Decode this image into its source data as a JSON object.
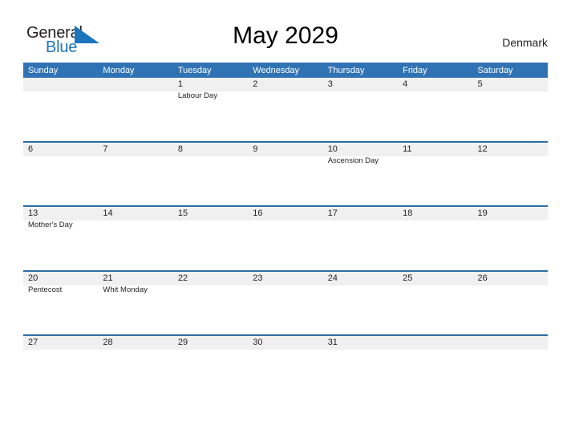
{
  "brand": {
    "name_part1": "General",
    "name_part2": "Blue",
    "flag_icon": "triangle-flag-icon",
    "flag_color": "#1c75bc"
  },
  "header": {
    "title": "May 2029",
    "country": "Denmark"
  },
  "theme": {
    "header_blue": "#3073b4",
    "separator_blue": "#2e6da4",
    "band_grey": "#f0f0f0",
    "text_dark": "#231f20",
    "logo_blue": "#1c75bc"
  },
  "calendar": {
    "month": "May",
    "year": "2029",
    "weekday_headers": [
      "Sunday",
      "Monday",
      "Tuesday",
      "Wednesday",
      "Thursday",
      "Friday",
      "Saturday"
    ],
    "weeks": [
      [
        {
          "day": "",
          "event": ""
        },
        {
          "day": "",
          "event": ""
        },
        {
          "day": "1",
          "event": "Labour Day"
        },
        {
          "day": "2",
          "event": ""
        },
        {
          "day": "3",
          "event": ""
        },
        {
          "day": "4",
          "event": ""
        },
        {
          "day": "5",
          "event": ""
        }
      ],
      [
        {
          "day": "6",
          "event": ""
        },
        {
          "day": "7",
          "event": ""
        },
        {
          "day": "8",
          "event": ""
        },
        {
          "day": "9",
          "event": ""
        },
        {
          "day": "10",
          "event": "Ascension Day"
        },
        {
          "day": "11",
          "event": ""
        },
        {
          "day": "12",
          "event": ""
        }
      ],
      [
        {
          "day": "13",
          "event": "Mother's Day"
        },
        {
          "day": "14",
          "event": ""
        },
        {
          "day": "15",
          "event": ""
        },
        {
          "day": "16",
          "event": ""
        },
        {
          "day": "17",
          "event": ""
        },
        {
          "day": "18",
          "event": ""
        },
        {
          "day": "19",
          "event": ""
        }
      ],
      [
        {
          "day": "20",
          "event": "Pentecost"
        },
        {
          "day": "21",
          "event": "Whit Monday"
        },
        {
          "day": "22",
          "event": ""
        },
        {
          "day": "23",
          "event": ""
        },
        {
          "day": "24",
          "event": ""
        },
        {
          "day": "25",
          "event": ""
        },
        {
          "day": "26",
          "event": ""
        }
      ],
      [
        {
          "day": "27",
          "event": ""
        },
        {
          "day": "28",
          "event": ""
        },
        {
          "day": "29",
          "event": ""
        },
        {
          "day": "30",
          "event": ""
        },
        {
          "day": "31",
          "event": ""
        },
        {
          "day": "",
          "event": ""
        },
        {
          "day": "",
          "event": ""
        }
      ]
    ]
  }
}
